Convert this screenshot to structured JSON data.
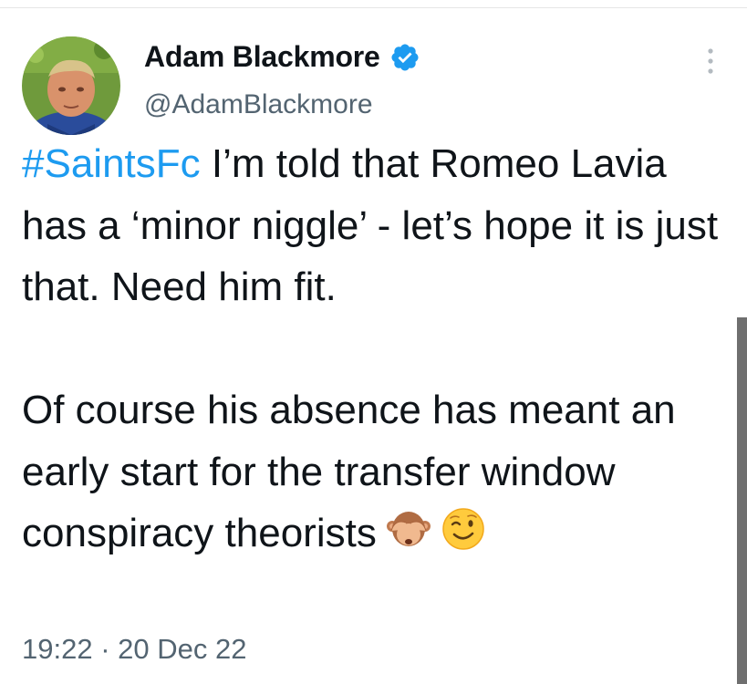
{
  "tweet": {
    "author": {
      "display_name": "Adam Blackmore",
      "handle": "@AdamBlackmore",
      "verified": true,
      "avatar_icon": "profile-photo"
    },
    "text": {
      "hashtag": "#SaintsFc",
      "paragraph1_rest": " I’m told that Romeo Lavia has a ‘minor niggle’ - let’s hope it is just that. Need him fit.",
      "paragraph2": "Of course his absence has meant an early start for the transfer window conspiracy theorists",
      "emojis": [
        "see-no-evil-monkey-icon",
        "winking-face-icon"
      ]
    },
    "timestamp": "19:22 · 20 Dec 22",
    "colors": {
      "link": "#1d9bf0",
      "verified_badge": "#1d9bf0",
      "secondary_text": "#536471",
      "primary_text": "#0f1419"
    },
    "more_icon": "more-options-icon"
  }
}
